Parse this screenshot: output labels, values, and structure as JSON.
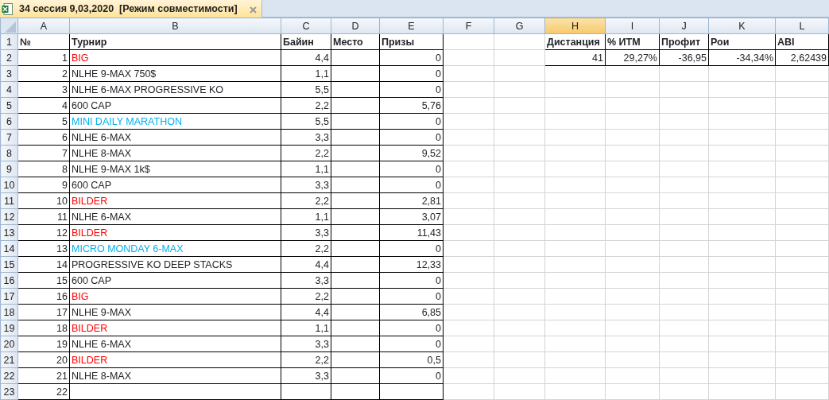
{
  "tab": {
    "title": "34 сессия 9,03,2020  [Режим совместимости]"
  },
  "columns": [
    {
      "label": "A",
      "selected": false
    },
    {
      "label": "B",
      "selected": false
    },
    {
      "label": "C",
      "selected": false
    },
    {
      "label": "D",
      "selected": false
    },
    {
      "label": "E",
      "selected": false
    },
    {
      "label": "F",
      "selected": false
    },
    {
      "label": "G",
      "selected": false
    },
    {
      "label": "H",
      "selected": true
    },
    {
      "label": "I",
      "selected": false
    },
    {
      "label": "J",
      "selected": false
    },
    {
      "label": "K",
      "selected": false
    },
    {
      "label": "L",
      "selected": false
    }
  ],
  "rows": [
    {
      "number": "1",
      "kind": "header",
      "cells": {
        "A": "№",
        "B": "Турнир",
        "C": "Байин",
        "D": "Место",
        "E": "Призы",
        "H": "Дистанция",
        "I": "% ИТМ",
        "J": "Профит",
        "K": "Рои",
        "L": "ABI"
      }
    },
    {
      "number": "2",
      "color": "#ff0000",
      "cells": {
        "A": "1",
        "B": "BIG",
        "C": "4,4",
        "E": "0",
        "H": "41",
        "I": "29,27%",
        "J": "-36,95",
        "K": "-34,34%",
        "L": "2,62439"
      }
    },
    {
      "number": "3",
      "cells": {
        "A": "2",
        "B": "NLHE 9-MAX 750$",
        "C": "1,1",
        "E": "0"
      }
    },
    {
      "number": "4",
      "cells": {
        "A": "3",
        "B": "NLHE 6-MAX PROGRESSIVE KO",
        "C": "5,5",
        "E": "0"
      }
    },
    {
      "number": "5",
      "cells": {
        "A": "4",
        "B": "600 CAP",
        "C": "2,2",
        "E": "5,76"
      }
    },
    {
      "number": "6",
      "color": "#00b0f0",
      "cells": {
        "A": "5",
        "B": "MINI DAILY MARATHON",
        "C": "5,5",
        "E": "0"
      }
    },
    {
      "number": "7",
      "cells": {
        "A": "6",
        "B": "NLHE 6-MAX",
        "C": "3,3",
        "E": "0"
      }
    },
    {
      "number": "8",
      "cells": {
        "A": "7",
        "B": "NLHE 8-MAX",
        "C": "2,2",
        "E": "9,52"
      }
    },
    {
      "number": "9",
      "cells": {
        "A": "8",
        "B": "NLHE 9-MAX 1k$",
        "C": "1,1",
        "E": "0"
      }
    },
    {
      "number": "10",
      "cells": {
        "A": "9",
        "B": "600 CAP",
        "C": "3,3",
        "E": "0"
      }
    },
    {
      "number": "11",
      "color": "#ff0000",
      "cells": {
        "A": "10",
        "B": "BILDER",
        "C": "2,2",
        "E": "2,81"
      }
    },
    {
      "number": "12",
      "cells": {
        "A": "11",
        "B": "NLHE 6-MAX",
        "C": "1,1",
        "E": "3,07"
      }
    },
    {
      "number": "13",
      "color": "#ff0000",
      "cells": {
        "A": "12",
        "B": "BILDER",
        "C": "3,3",
        "E": "11,43"
      }
    },
    {
      "number": "14",
      "color": "#00b0f0",
      "cells": {
        "A": "13",
        "B": "MICRO MONDAY 6-MAX",
        "C": "2,2",
        "E": "0"
      }
    },
    {
      "number": "15",
      "cells": {
        "A": "14",
        "B": "PROGRESSIVE KO DEEP STACKS",
        "C": "4,4",
        "E": "12,33"
      }
    },
    {
      "number": "16",
      "cells": {
        "A": "15",
        "B": "600 CAP",
        "C": "3,3",
        "E": "0"
      }
    },
    {
      "number": "17",
      "color": "#ff0000",
      "cells": {
        "A": "16",
        "B": "BIG",
        "C": "2,2",
        "E": "0"
      }
    },
    {
      "number": "18",
      "cells": {
        "A": "17",
        "B": "NLHE 9-MAX",
        "C": "4,4",
        "E": "6,85"
      }
    },
    {
      "number": "19",
      "color": "#ff0000",
      "cells": {
        "A": "18",
        "B": "BILDER",
        "C": "1,1",
        "E": "0"
      }
    },
    {
      "number": "20",
      "cells": {
        "A": "19",
        "B": "NLHE 6-MAX",
        "C": "3,3",
        "E": "0"
      }
    },
    {
      "number": "21",
      "color": "#ff0000",
      "cells": {
        "A": "20",
        "B": "BILDER",
        "C": "2,2",
        "E": "0,5"
      }
    },
    {
      "number": "22",
      "cells": {
        "A": "21",
        "B": "NLHE 8-MAX",
        "C": "3,3",
        "E": "0"
      }
    },
    {
      "number": "23",
      "cells": {
        "A": "22"
      }
    }
  ]
}
